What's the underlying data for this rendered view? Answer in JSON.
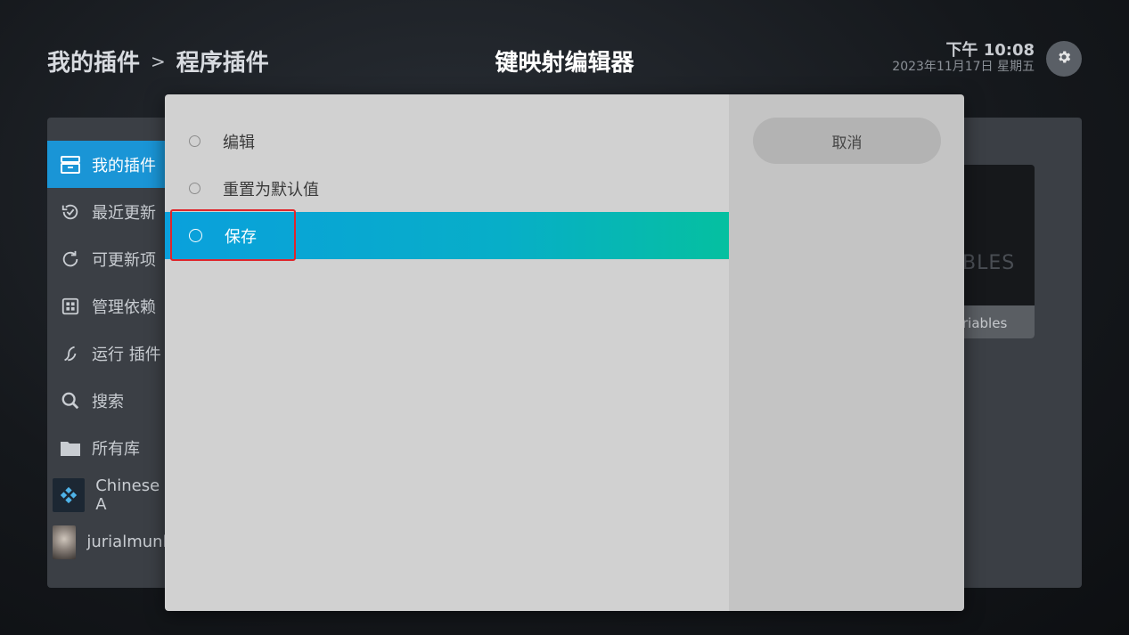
{
  "header": {
    "breadcrumb": [
      "我的插件",
      "程序插件"
    ],
    "breadcrumb_separator": ">",
    "title": "键映射编辑器",
    "time": "下午 10:08",
    "date": "2023年11月17日 星期五"
  },
  "sidebar": {
    "items": [
      {
        "label": "我的插件",
        "icon": "addons-box-icon"
      },
      {
        "label": "最近更新",
        "icon": "recent-update-icon"
      },
      {
        "label": "可更新项",
        "icon": "refresh-icon"
      },
      {
        "label": "管理依赖",
        "icon": "dependencies-icon"
      },
      {
        "label": "运行 插件",
        "icon": "run-addon-icon"
      },
      {
        "label": "搜索",
        "icon": "search-icon"
      },
      {
        "label": "所有库",
        "icon": "folder-icon"
      },
      {
        "label": "Chinese A",
        "icon": "kodi-thumb"
      },
      {
        "label": "jurialmunk",
        "icon": "avatar-thumb"
      }
    ]
  },
  "background_card": {
    "text": "BLES",
    "label": "riables"
  },
  "dialog": {
    "options": [
      {
        "label": "编辑",
        "selected": false
      },
      {
        "label": "重置为默认值",
        "selected": false
      },
      {
        "label": "保存",
        "selected": true
      }
    ],
    "cancel_label": "取消"
  },
  "colors": {
    "accent": "#1a95d6",
    "selection_gradient_start": "#0aa0dc",
    "selection_gradient_end": "#05c0a0",
    "highlight_border": "#e0262b"
  }
}
